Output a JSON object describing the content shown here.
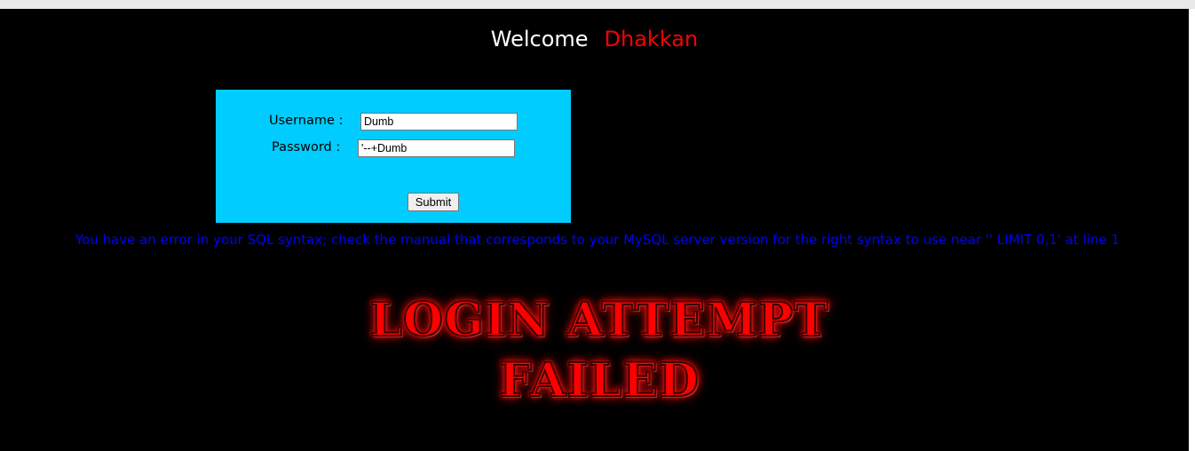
{
  "header": {
    "welcome_text": "Welcome",
    "name_text": "Dhakkan"
  },
  "login_form": {
    "username_label": "Username :",
    "username_value": "Dumb",
    "password_label": "Password :",
    "password_value": "'--+Dumb",
    "submit_label": "Submit"
  },
  "error": {
    "message": "You have an error in your SQL syntax; check the manual that corresponds to your MySQL server version for the right syntax to use near '' LIMIT 0,1' at line 1"
  },
  "result_banner": {
    "line1": "LOGIN ATTEMPT",
    "line2": "FAILED"
  },
  "colors": {
    "background": "#000000",
    "form_background": "#00ccff",
    "welcome_color": "#ffffff",
    "name_color": "#ff0000",
    "error_color": "#0000ff"
  }
}
